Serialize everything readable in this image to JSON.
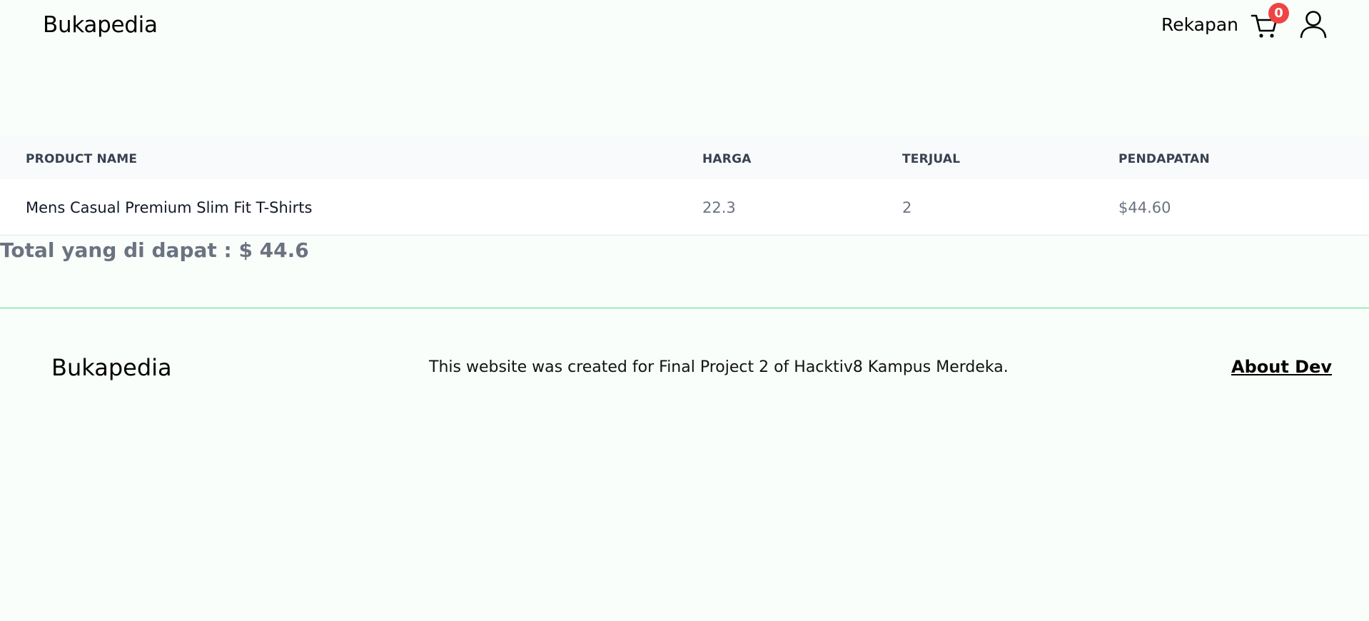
{
  "header": {
    "brand": "Bukapedia",
    "nav_link": "Rekapan",
    "cart_count": "0",
    "cart_icon": "shopping-cart-icon",
    "user_icon": "user-icon",
    "badge_color": "#ef4444"
  },
  "table": {
    "columns": [
      "PRODUCT NAME",
      "HARGA",
      "TERJUAL",
      "PENDAPATAN"
    ],
    "rows": [
      {
        "name": "Mens Casual Premium Slim Fit T-Shirts",
        "harga": "22.3",
        "terjual": "2",
        "pendapatan": "$44.60"
      }
    ]
  },
  "summary": {
    "total": "Total yang di dapat : $ 44.6"
  },
  "footer": {
    "brand": "Bukapedia",
    "text": "This website was created for Final Project 2 of Hacktiv8 Kampus Merdeka.",
    "about_link": "About Dev",
    "line_color": "#4ade80"
  }
}
